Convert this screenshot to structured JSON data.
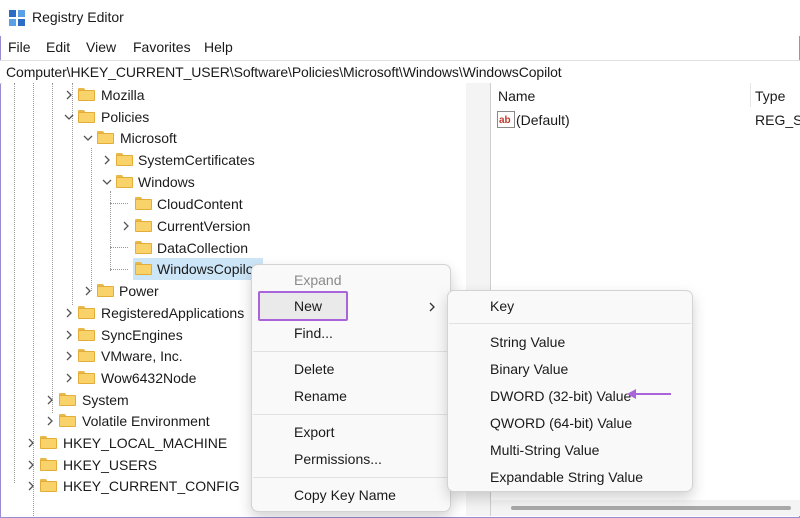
{
  "window": {
    "title": "Registry Editor"
  },
  "menubar": [
    "File",
    "Edit",
    "View",
    "Favorites",
    "Help"
  ],
  "address": "Computer\\HKEY_CURRENT_USER\\Software\\Policies\\Microsoft\\Windows\\WindowsCopilot",
  "tree": {
    "nodes": [
      {
        "label": "Mozilla",
        "expanded": false
      },
      {
        "label": "Policies",
        "expanded": true
      },
      {
        "label": "Microsoft",
        "expanded": true
      },
      {
        "label": "SystemCertificates",
        "expanded": false
      },
      {
        "label": "Windows",
        "expanded": true
      },
      {
        "label": "CloudContent",
        "expanded": null
      },
      {
        "label": "CurrentVersion",
        "expanded": false
      },
      {
        "label": "DataCollection",
        "expanded": null
      },
      {
        "label": "WindowsCopilot",
        "expanded": null,
        "selected": true
      },
      {
        "label": "Power",
        "expanded": false
      },
      {
        "label": "RegisteredApplications",
        "expanded": false
      },
      {
        "label": "SyncEngines",
        "expanded": false
      },
      {
        "label": "VMware, Inc.",
        "expanded": false
      },
      {
        "label": "Wow6432Node",
        "expanded": false
      },
      {
        "label": "System",
        "expanded": false
      },
      {
        "label": "Volatile Environment",
        "expanded": false
      },
      {
        "label": "HKEY_LOCAL_MACHINE",
        "expanded": false
      },
      {
        "label": "HKEY_USERS",
        "expanded": false
      },
      {
        "label": "HKEY_CURRENT_CONFIG",
        "expanded": false
      }
    ]
  },
  "values_pane": {
    "columns": [
      "Name",
      "Type"
    ],
    "rows": [
      {
        "name": "(Default)",
        "type": "REG_SZ",
        "icon": "string-value-icon"
      }
    ]
  },
  "context_menu": {
    "items": [
      "Expand",
      "New",
      "Find...",
      "Delete",
      "Rename",
      "Export",
      "Permissions...",
      "Copy Key Name"
    ],
    "disabled": [
      "Expand"
    ],
    "highlighted": "New"
  },
  "submenu": {
    "items": [
      "Key",
      "String Value",
      "Binary Value",
      "DWORD (32-bit) Value",
      "QWORD (64-bit) Value",
      "Multi-String Value",
      "Expandable String Value"
    ],
    "annotated": "DWORD (32-bit) Value"
  },
  "colors": {
    "highlight_outline": "#a864d8",
    "selection": "#cde6f7",
    "folder": "#f9d26a"
  }
}
